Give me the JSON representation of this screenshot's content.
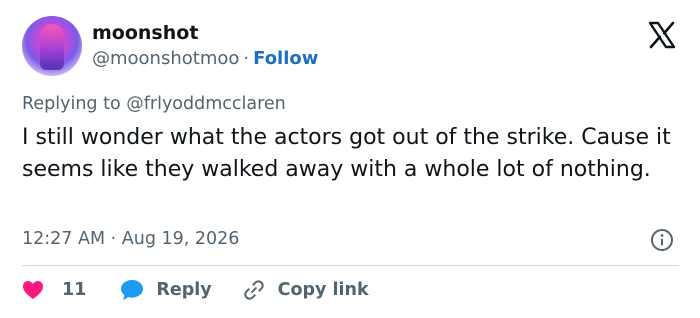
{
  "author": {
    "display_name": "moonshot",
    "handle": "@moonshotmoo",
    "separator": "·",
    "follow_label": "Follow"
  },
  "reply_context": "Replying to @frlyoddmcclaren",
  "tweet": {
    "text": "I still wonder what the actors got out of the strike. Cause it seems like they walked away with a whole lot of nothing.",
    "timestamp": "12:27 AM · Aug 19, 2026"
  },
  "actions": {
    "like_count": "11",
    "reply_label": "Reply",
    "copy_label": "Copy link"
  },
  "colors": {
    "like": "#f91880",
    "reply": "#1d9bf0",
    "link": "#1d6fc0",
    "muted": "#536471"
  },
  "icons": [
    "x-logo-icon",
    "info-icon",
    "heart-icon",
    "reply-bubble-icon",
    "link-icon"
  ]
}
